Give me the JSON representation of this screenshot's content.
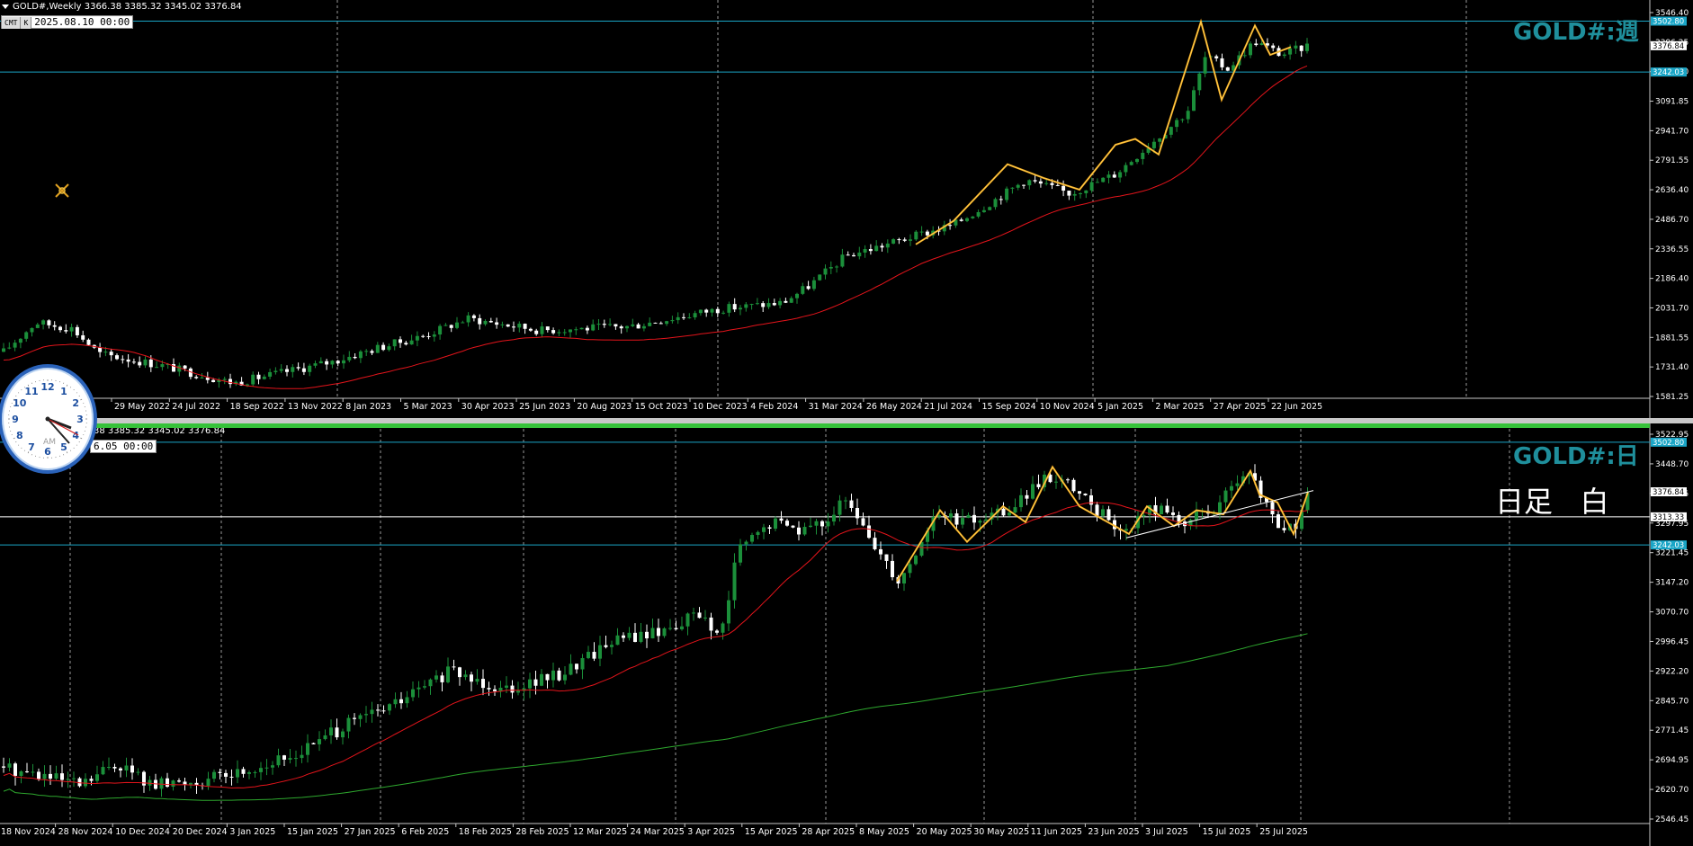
{
  "top": {
    "info": "GOLD#,Weekly  3366.38 3385.32 3345.02 3376.84",
    "title": "GOLD#:週",
    "tags": [
      "CMT",
      "K"
    ],
    "datetime": "2025.08.10 00:00",
    "price_labels": [
      "3546.40",
      "3396.25",
      "3241.10",
      "3091.85",
      "2941.70",
      "2791.55",
      "2636.40",
      "2486.70",
      "2336.55",
      "2186.40",
      "2031.70",
      "1881.55",
      "1731.40",
      "1581.25"
    ],
    "h_lines": [
      "3502.80",
      "3242.03"
    ],
    "current_price": "3376.84",
    "date_labels": [
      "29 May 2022",
      "24 Jul 2022",
      "18 Sep 2022",
      "13 Nov 2022",
      "8 Jan 2023",
      "5 Mar 2023",
      "30 Apr 2023",
      "25 Jun 2023",
      "20 Aug 2023",
      "15 Oct 2023",
      "10 Dec 2023",
      "4 Feb 2024",
      "31 Mar 2024",
      "26 May 2024",
      "21 Jul 2024",
      "15 Sep 2024",
      "10 Nov 2024",
      "5 Jan 2025",
      "2 Mar 2025",
      "27 Apr 2025",
      "22 Jun 2025"
    ]
  },
  "bottom": {
    "info": "38 3385.32 3345.02 3376.84",
    "title": "GOLD#:日",
    "label": "日足   白",
    "datetime": "6.05 00:00",
    "price_labels": [
      "3522.95",
      "3448.70",
      "3374.45",
      "3297.95",
      "3221.45",
      "3147.20",
      "3070.70",
      "2996.45",
      "2922.20",
      "2845.70",
      "2771.45",
      "2694.95",
      "2620.70",
      "2546.45"
    ],
    "h_lines": [
      "3502.80",
      "3242.03"
    ],
    "white_line": "3313.33",
    "current_price": "3376.84",
    "date_labels": [
      "18 Nov 2024",
      "28 Nov 2024",
      "10 Dec 2024",
      "20 Dec 2024",
      "3 Jan 2025",
      "15 Jan 2025",
      "27 Jan 2025",
      "6 Feb 2025",
      "18 Feb 2025",
      "28 Feb 2025",
      "12 Mar 2025",
      "24 Mar 2025",
      "3 Apr 2025",
      "15 Apr 2025",
      "28 Apr 2025",
      "8 May 2025",
      "20 May 2025",
      "30 May 2025",
      "11 Jun 2025",
      "23 Jun 2025",
      "3 Jul 2025",
      "15 Jul 2025",
      "25 Jul 2025"
    ]
  },
  "clock": {
    "numbers": [
      "12",
      "1",
      "2",
      "3",
      "4",
      "5",
      "6",
      "7",
      "8",
      "9",
      "10",
      "11"
    ],
    "am": "AM"
  },
  "colors": {
    "bull": "#1b8f3a",
    "bear": "#ffffff",
    "ma_red": "#e4141b",
    "ma_green": "#2ea82e",
    "zigzag": "#f2a51a",
    "hline": "#1aa5c6",
    "grid": "#9a9a9a",
    "title": "#1f8f9c"
  }
}
